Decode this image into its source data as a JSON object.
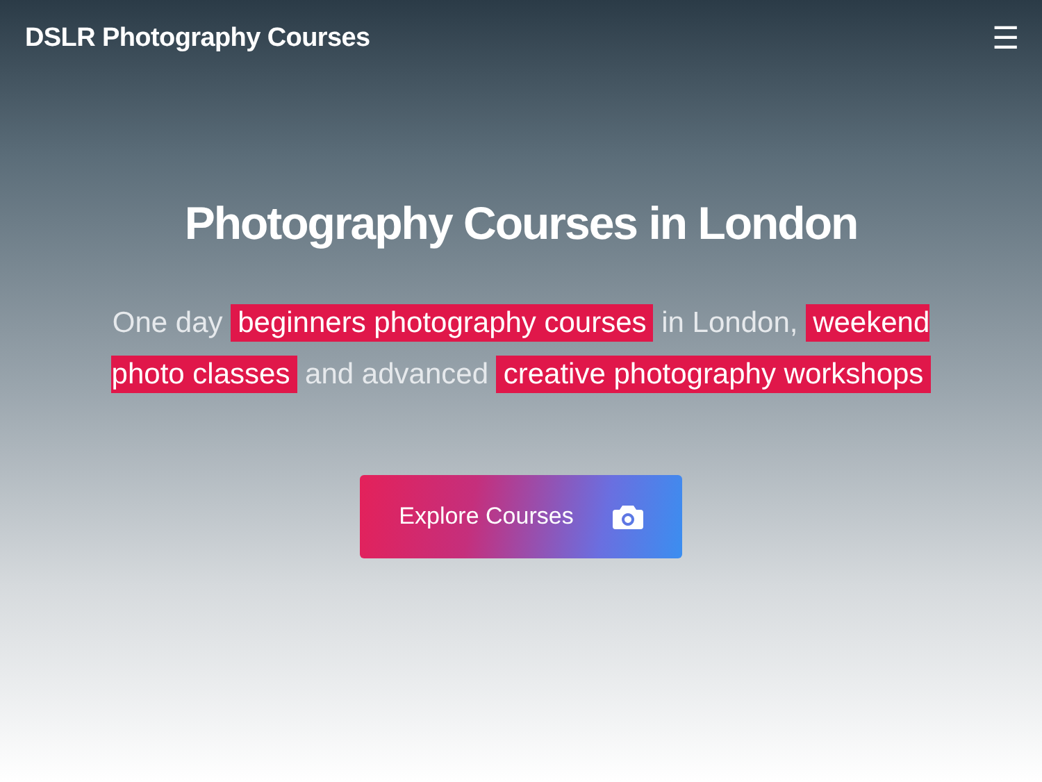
{
  "header": {
    "site_title": "DSLR Photography Courses",
    "menu_icon": "☰"
  },
  "hero": {
    "title": "Photography Courses in London",
    "subtitle": [
      {
        "text": "One day ",
        "highlighted": false
      },
      {
        "text": "beginners photography courses",
        "highlighted": true
      },
      {
        "text": " in London, ",
        "highlighted": false
      },
      {
        "text": "weekend photo classes",
        "highlighted": true
      },
      {
        "text": " and advanced ",
        "highlighted": false
      },
      {
        "text": "creative photography workshops",
        "highlighted": true
      }
    ],
    "button": {
      "label": "Explore Courses"
    }
  }
}
